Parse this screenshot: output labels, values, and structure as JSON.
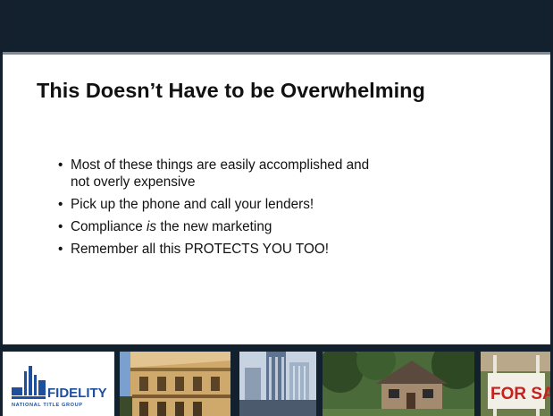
{
  "slide": {
    "title": "This Doesn’t Have to be Overwhelming",
    "bullets": [
      {
        "lines": [
          "Most of these things are easily accomplished and",
          "not overly expensive"
        ]
      },
      {
        "text": "Pick up the phone and call your lenders!"
      },
      {
        "before": "Compliance ",
        "italic": "is",
        "after": " the new marketing"
      },
      {
        "text": "Remember all this PROTECTS YOU TOO!"
      }
    ],
    "bullet_char": "•"
  },
  "logo": {
    "name": "FIDELITY",
    "subtitle": "NATIONAL TITLE GROUP",
    "color": "#1f4e9c"
  },
  "photos": {
    "sign_text": "FOR SALE"
  },
  "colors": {
    "band": "#13212f",
    "band_rule": "#7f8a94",
    "text": "#111111"
  }
}
